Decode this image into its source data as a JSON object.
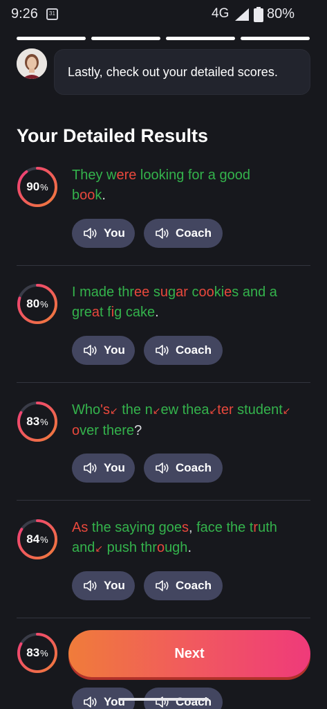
{
  "status_bar": {
    "time": "9:26",
    "calendar": "31",
    "network": "4G",
    "battery": "80%"
  },
  "progress": {
    "segments": 4,
    "completed": 4
  },
  "coach_message": "Lastly, check out your detailed scores.",
  "section_title": "Your Detailed Results",
  "buttons": {
    "you": "You",
    "coach": "Coach",
    "next": "Next"
  },
  "results": [
    {
      "score": "90",
      "percent_sign": "%",
      "segments": [
        {
          "t": "They w",
          "c": "g"
        },
        {
          "t": "ere",
          "c": "r"
        },
        {
          "t": " looking for a good",
          "c": "g"
        },
        {
          "t": "b",
          "c": "g"
        },
        {
          "t": "oo",
          "c": "r"
        },
        {
          "t": "k",
          "c": "g"
        },
        {
          "t": ".",
          "c": "w"
        }
      ]
    },
    {
      "score": "80",
      "percent_sign": "%",
      "segments": [
        {
          "t": "I made thr",
          "c": "g"
        },
        {
          "t": "ee",
          "c": "r"
        },
        {
          "t": " s",
          "c": "g"
        },
        {
          "t": "u",
          "c": "r"
        },
        {
          "t": "g",
          "c": "g"
        },
        {
          "t": "ar",
          "c": "r"
        },
        {
          "t": " c",
          "c": "g"
        },
        {
          "t": "oo",
          "c": "r"
        },
        {
          "t": "ki",
          "c": "g"
        },
        {
          "t": "e",
          "c": "r"
        },
        {
          "t": "s and a",
          "c": "g"
        },
        {
          "t": "gre",
          "c": "g"
        },
        {
          "t": "a",
          "c": "r"
        },
        {
          "t": "t f",
          "c": "g"
        },
        {
          "t": "i",
          "c": "r"
        },
        {
          "t": "g cake",
          "c": "g"
        },
        {
          "t": ".",
          "c": "w"
        }
      ]
    },
    {
      "score": "83",
      "percent_sign": "%",
      "segments": [
        {
          "t": "Who",
          "c": "g"
        },
        {
          "t": "'s",
          "c": "r"
        },
        {
          "t": "↙",
          "c": "arr"
        },
        {
          "t": " the n",
          "c": "g"
        },
        {
          "t": "↙",
          "c": "arr"
        },
        {
          "t": "ew thea",
          "c": "g"
        },
        {
          "t": "↙",
          "c": "arr"
        },
        {
          "t": "ter",
          "c": "r"
        },
        {
          "t": " student",
          "c": "g"
        },
        {
          "t": "↙",
          "c": "arr"
        },
        {
          "t": "o",
          "c": "r"
        },
        {
          "t": "ver there",
          "c": "g"
        },
        {
          "t": "?",
          "c": "w"
        }
      ]
    },
    {
      "score": "84",
      "percent_sign": "%",
      "segments": [
        {
          "t": "As",
          "c": "r"
        },
        {
          "t": " the saying goe",
          "c": "g"
        },
        {
          "t": "s",
          "c": "r"
        },
        {
          "t": ",",
          "c": "w"
        },
        {
          "t": " face the t",
          "c": "g"
        },
        {
          "t": "r",
          "c": "r"
        },
        {
          "t": "uth",
          "c": "g"
        },
        {
          "t": "and",
          "c": "g"
        },
        {
          "t": "↙",
          "c": "arr"
        },
        {
          "t": " push thr",
          "c": "g"
        },
        {
          "t": "o",
          "c": "r"
        },
        {
          "t": "ugh",
          "c": "g"
        },
        {
          "t": ".",
          "c": "w"
        }
      ]
    },
    {
      "score": "83",
      "percent_sign": "%",
      "segments": []
    }
  ],
  "colors": {
    "correct": "#34b34c",
    "incorrect": "#e8483c",
    "ring_start": "#f07c3a",
    "ring_end": "#ef3a7a",
    "button_bg": "#434660"
  }
}
